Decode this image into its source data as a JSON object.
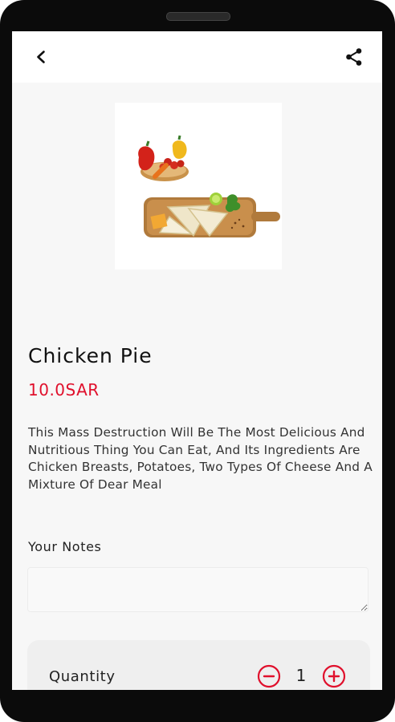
{
  "header": {
    "back_icon": "chevron-left-icon",
    "share_icon": "share-icon"
  },
  "product": {
    "name": "Chicken Pie",
    "price": "10.0SAR",
    "description": "This Mass Destruction Will Be The Most Delicious And Nutritious Thing You Can Eat, And Its Ingredients Are Chicken Breasts, Potatoes, Two Types Of Cheese And A Mixture Of Dear Meal"
  },
  "notes": {
    "label": "Your Notes",
    "value": "",
    "placeholder": ""
  },
  "quantity": {
    "label": "Quantity",
    "value": "1",
    "minus_icon": "minus-circle-icon",
    "plus_icon": "plus-circle-icon"
  },
  "colors": {
    "accent": "#e0102c",
    "background": "#f7f7f7",
    "appbar": "#ffffff"
  }
}
